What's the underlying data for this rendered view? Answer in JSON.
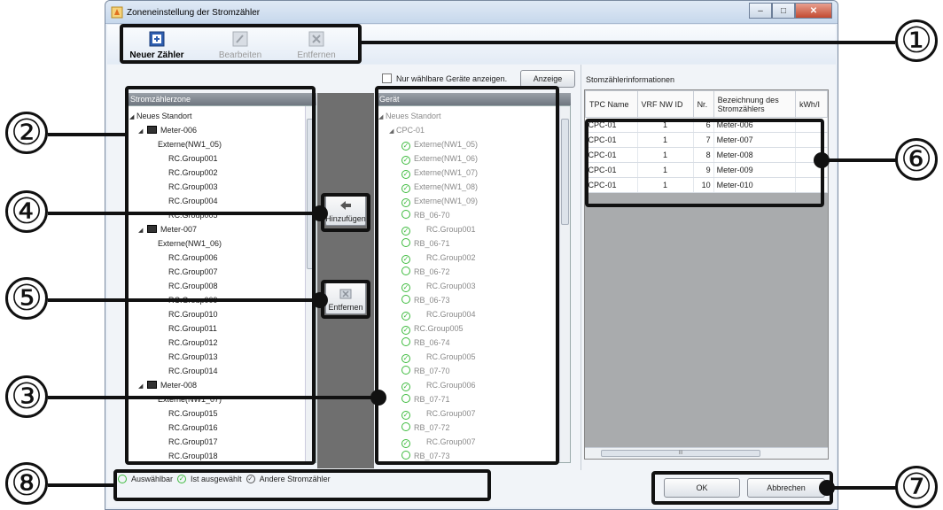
{
  "window": {
    "title": "Zoneneinstellung der Stromzähler"
  },
  "toolbar": {
    "new_label": "Neuer Zähler",
    "edit_label": "Bearbeiten",
    "remove_label": "Entfernen"
  },
  "filter": {
    "checkbox_label": "Nur wählbare Geräte anzeigen.",
    "show_button": "Anzeige"
  },
  "meter_zone": {
    "header": "Stromzählerzone",
    "root": "Neues Standort",
    "meters": [
      {
        "name": "Meter-006",
        "external": "Externe(NW1_05)",
        "groups": [
          "RC.Group001",
          "RC.Group002",
          "RC.Group003",
          "RC.Group004",
          "RC.Group005"
        ]
      },
      {
        "name": "Meter-007",
        "external": "Externe(NW1_06)",
        "groups": [
          "RC.Group006",
          "RC.Group007",
          "RC.Group008",
          "RC.Group009",
          "RC.Group010",
          "RC.Group011",
          "RC.Group012",
          "RC.Group013",
          "RC.Group014"
        ]
      },
      {
        "name": "Meter-008",
        "external": "Externe(NW1_07)",
        "groups": [
          "RC.Group015",
          "RC.Group016",
          "RC.Group017",
          "RC.Group018"
        ]
      }
    ]
  },
  "side_buttons": {
    "add": "Hinzufügen",
    "remove": "Entfernen"
  },
  "device": {
    "header": "Gerät",
    "root": "Neues Standort",
    "controller": "CPC-01",
    "items": [
      {
        "label": "Externe(NW1_05)",
        "state": "other",
        "level": 1
      },
      {
        "label": "Externe(NW1_06)",
        "state": "other",
        "level": 1
      },
      {
        "label": "Externe(NW1_07)",
        "state": "other",
        "level": 1
      },
      {
        "label": "Externe(NW1_08)",
        "state": "other",
        "level": 1
      },
      {
        "label": "Externe(NW1_09)",
        "state": "other",
        "level": 1
      },
      {
        "label": "RB_06-70",
        "state": "selectable",
        "level": 1
      },
      {
        "label": "RC.Group001",
        "state": "other",
        "level": 2
      },
      {
        "label": "RB_06-71",
        "state": "selectable",
        "level": 1
      },
      {
        "label": "RC.Group002",
        "state": "other",
        "level": 2
      },
      {
        "label": "RB_06-72",
        "state": "selectable",
        "level": 1
      },
      {
        "label": "RC.Group003",
        "state": "other",
        "level": 2
      },
      {
        "label": "RB_06-73",
        "state": "selectable",
        "level": 1
      },
      {
        "label": "RC.Group004",
        "state": "other",
        "level": 2
      },
      {
        "label": "RC.Group005",
        "state": "other",
        "level": 1
      },
      {
        "label": "RB_06-74",
        "state": "selectable",
        "level": 1
      },
      {
        "label": "RC.Group005",
        "state": "other",
        "level": 2
      },
      {
        "label": "RB_07-70",
        "state": "selectable",
        "level": 1
      },
      {
        "label": "RC.Group006",
        "state": "other",
        "level": 2
      },
      {
        "label": "RB_07-71",
        "state": "selectable",
        "level": 1
      },
      {
        "label": "RC.Group007",
        "state": "other",
        "level": 2
      },
      {
        "label": "RB_07-72",
        "state": "selectable",
        "level": 1
      },
      {
        "label": "RC.Group007",
        "state": "other",
        "level": 2
      },
      {
        "label": "RB_07-73",
        "state": "selectable",
        "level": 1
      }
    ]
  },
  "info": {
    "header": "Stomzählerinformationen",
    "columns": [
      "TPC Name",
      "VRF NW ID",
      "Nr.",
      "Bezeichnung des Stromzählers",
      "kWh/I"
    ],
    "rows": [
      [
        "CPC-01",
        "1",
        "6",
        "Meter-006"
      ],
      [
        "CPC-01",
        "1",
        "7",
        "Meter-007"
      ],
      [
        "CPC-01",
        "1",
        "8",
        "Meter-008"
      ],
      [
        "CPC-01",
        "1",
        "9",
        "Meter-009"
      ],
      [
        "CPC-01",
        "1",
        "10",
        "Meter-010"
      ]
    ],
    "hscroll_mark": "III"
  },
  "legend": {
    "selectable": "Auswählbar",
    "selected": "Ist ausgewählt",
    "other": "Andere Stromzähler"
  },
  "footer": {
    "ok": "OK",
    "cancel": "Abbrechen"
  },
  "callouts": [
    "①",
    "②",
    "③",
    "④",
    "⑤",
    "⑥",
    "⑦",
    "⑧"
  ],
  "colors": {
    "check_green": "#3dbb3d",
    "mid_gray": "#6f6f6f",
    "header_gray": "#7b828b"
  }
}
